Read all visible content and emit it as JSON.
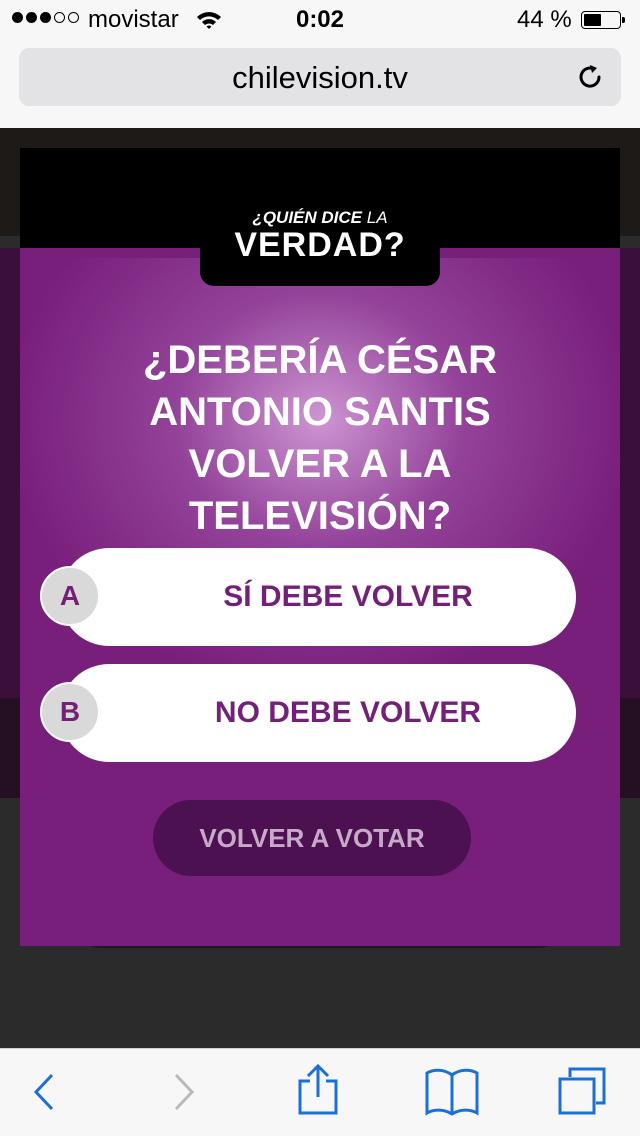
{
  "status_bar": {
    "carrier": "movistar",
    "time": "0:02",
    "battery_percent": "44 %",
    "battery_level": 0.44
  },
  "browser": {
    "url": "chilevision.tv"
  },
  "modal": {
    "logo": {
      "line1_bold": "¿QUIÉN DICE",
      "line1_thin": "LA",
      "line2": "VERDAD?"
    },
    "question": "¿DEBERÍA CÉSAR ANTONIO SANTIS VOLVER A LA TELEVISIÓN?",
    "options": [
      {
        "letter": "A",
        "label": "SÍ DEBE VOLVER"
      },
      {
        "letter": "B",
        "label": "NO DEBE VOLVER"
      }
    ],
    "revote_label": "VOLVER A VOTAR"
  },
  "colors": {
    "brand_purple": "#781e7b",
    "option_text": "#741f79",
    "ios_blue": "#1a6fe0"
  },
  "toolbar_icons": [
    "back-icon",
    "forward-icon",
    "share-icon",
    "bookmarks-icon",
    "tabs-icon"
  ]
}
